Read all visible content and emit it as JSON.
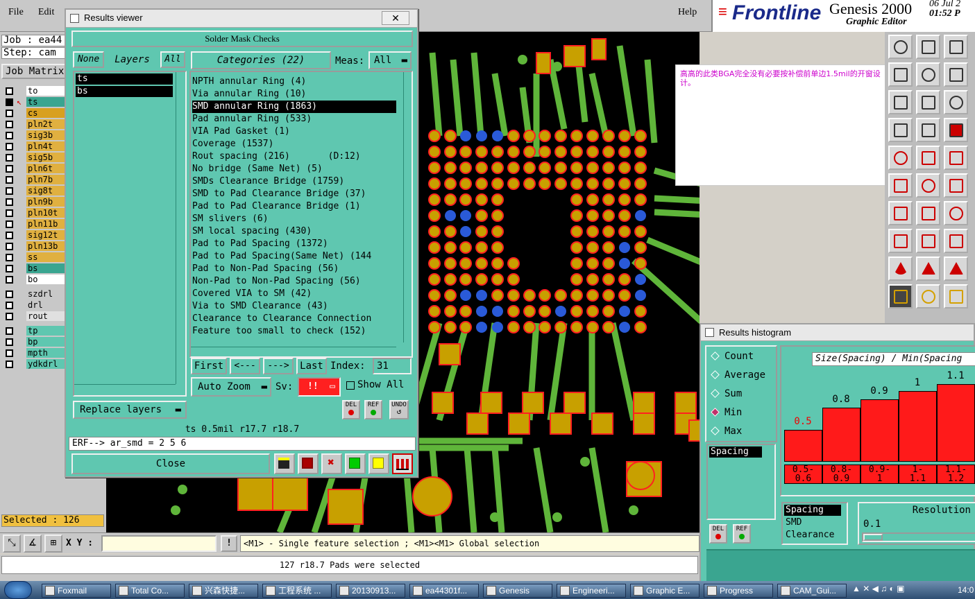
{
  "menubar": {
    "file": "File",
    "edit": "Edit",
    "help": "Help"
  },
  "brand": {
    "logo": "Frontline",
    "product": "Genesis 2000",
    "subtitle": "Graphic Editor",
    "date": "06 Jul 2",
    "time": "01:52 P"
  },
  "left": {
    "job_label": "Job : ea44",
    "step_label": "Step: cam",
    "job_matrix": "Job Matrix",
    "layers": [
      {
        "name": "to",
        "color": "#ffffff"
      },
      {
        "name": "ts",
        "color": "#3aa590"
      },
      {
        "name": "cs",
        "color": "#d8a020"
      },
      {
        "name": "pln2t",
        "color": "#e0b040"
      },
      {
        "name": "sig3b",
        "color": "#e0b040"
      },
      {
        "name": "pln4t",
        "color": "#e0b040"
      },
      {
        "name": "sig5b",
        "color": "#e0b040"
      },
      {
        "name": "pln6t",
        "color": "#e0b040"
      },
      {
        "name": "pln7b",
        "color": "#e0b040"
      },
      {
        "name": "sig8t",
        "color": "#e0b040"
      },
      {
        "name": "pln9b",
        "color": "#e0b040"
      },
      {
        "name": "pln10t",
        "color": "#e0b040"
      },
      {
        "name": "pln11b",
        "color": "#e0b040"
      },
      {
        "name": "sig12t",
        "color": "#e0b040"
      },
      {
        "name": "pln13b",
        "color": "#e0b040"
      },
      {
        "name": "ss",
        "color": "#e0b040"
      },
      {
        "name": "bs",
        "color": "#3aa590"
      },
      {
        "name": "bo",
        "color": "#ffffff"
      },
      {
        "name": "szdrl",
        "color": "#c8c8c8"
      },
      {
        "name": "drl",
        "color": "#c8c8c8"
      },
      {
        "name": "rout",
        "color": "#e0e0e0"
      },
      {
        "name": "tp",
        "color": "#5fc7b0"
      },
      {
        "name": "bp",
        "color": "#5fc7b0"
      },
      {
        "name": "mpth",
        "color": "#5fc7b0"
      },
      {
        "name": "ydkdrl",
        "color": "#5fc7b0"
      }
    ],
    "selected": "Selected : 126"
  },
  "rv": {
    "window_title": "Results viewer",
    "header": "Solder Mask Checks",
    "btn_none": "None",
    "btn_layers": "Layers",
    "btn_all": "All",
    "layer_list": [
      "ts",
      "bs"
    ],
    "categories_label": "Categories (22)",
    "meas_label": "Meas:",
    "meas_value": "All",
    "categories": [
      "NPTH annular Ring (4)",
      "Via annular Ring (10)",
      "SMD annular Ring (1863)",
      "Pad annular Ring (533)",
      "VIA Pad Gasket (1)",
      "Coverage (1537)",
      "Rout spacing (216)       (D:12)",
      "No bridge (Same Net) (5)",
      "SMDs Clearance Bridge (1759)",
      "SMD to Pad Clearance Bridge (37)",
      "Pad to Pad Clearance Bridge (1)",
      "SM slivers (6)",
      "SM local spacing (430)",
      "Pad to Pad Spacing (1372)",
      "Pad to Pad Spacing(Same Net) (144",
      "Pad to Non-Pad Spacing (56)",
      "Non-Pad to Non-Pad Spacing (56)",
      "Covered VIA to SM (42)",
      "Via to SMD Clearance (43)",
      "Clearance to Clearance Connection",
      "Feature too small to check (152)"
    ],
    "selected_index": 2,
    "first": "First",
    "prev": "<---",
    "next": "--->",
    "last": "Last",
    "index_label": "Index:",
    "index_value": "31",
    "auto_zoom": "Auto Zoom",
    "sv": "Sv:",
    "sv_value": "!!",
    "show_all": "Show All",
    "replace_layers": "Replace layers",
    "del": "DEL",
    "ref": "REF",
    "undo": "UNDO",
    "info": "ts 0.5mil  r17.7  r18.7",
    "erf": "ERF--> ar_smd = 2 5 6",
    "close": "Close"
  },
  "note": {
    "text": "高高的此类BGA完全没有必要按补偿前单边1.5mil的开窗设计。"
  },
  "hist": {
    "window_title": "Results histogram",
    "radios": [
      "Count",
      "Average",
      "Sum",
      "Min",
      "Max"
    ],
    "selected_radio": "Min",
    "title": "Size(Spacing) / Min(Spacing",
    "measure_list": [
      "Spacing"
    ],
    "del": "DEL",
    "ref": "REF",
    "bars": [
      {
        "value": "0.5",
        "range": "0.5-\n0.6",
        "level": 0.27
      },
      {
        "value": "0.8",
        "range": "0.8-\n0.9",
        "level": 0.46
      },
      {
        "value": "0.9",
        "range": "0.9-\n1",
        "level": 0.53
      },
      {
        "value": "1",
        "range": "1-\n1.1",
        "level": 0.6
      },
      {
        "value": "1.1",
        "range": "1.1-\n1.2",
        "level": 0.66
      }
    ],
    "metric_list": [
      "Spacing",
      "SMD",
      "Clearance"
    ],
    "resolution_label": "Resolution",
    "resolution_value": "0.1"
  },
  "status": {
    "xy_label": "X Y :",
    "hint": "<M1> - Single feature selection ; <M1><M1> Global selection",
    "message": "127 r18.7 Pads were selected"
  },
  "taskbar": {
    "items": [
      "Foxmail",
      "Total Co...",
      "兴森快捷...",
      "工程系统 ...",
      "20130913...",
      "ea44301f...",
      "Genesis",
      "Engineeri...",
      "Graphic E...",
      "Progress",
      "CAM_Gui..."
    ],
    "clock": "14:0"
  }
}
